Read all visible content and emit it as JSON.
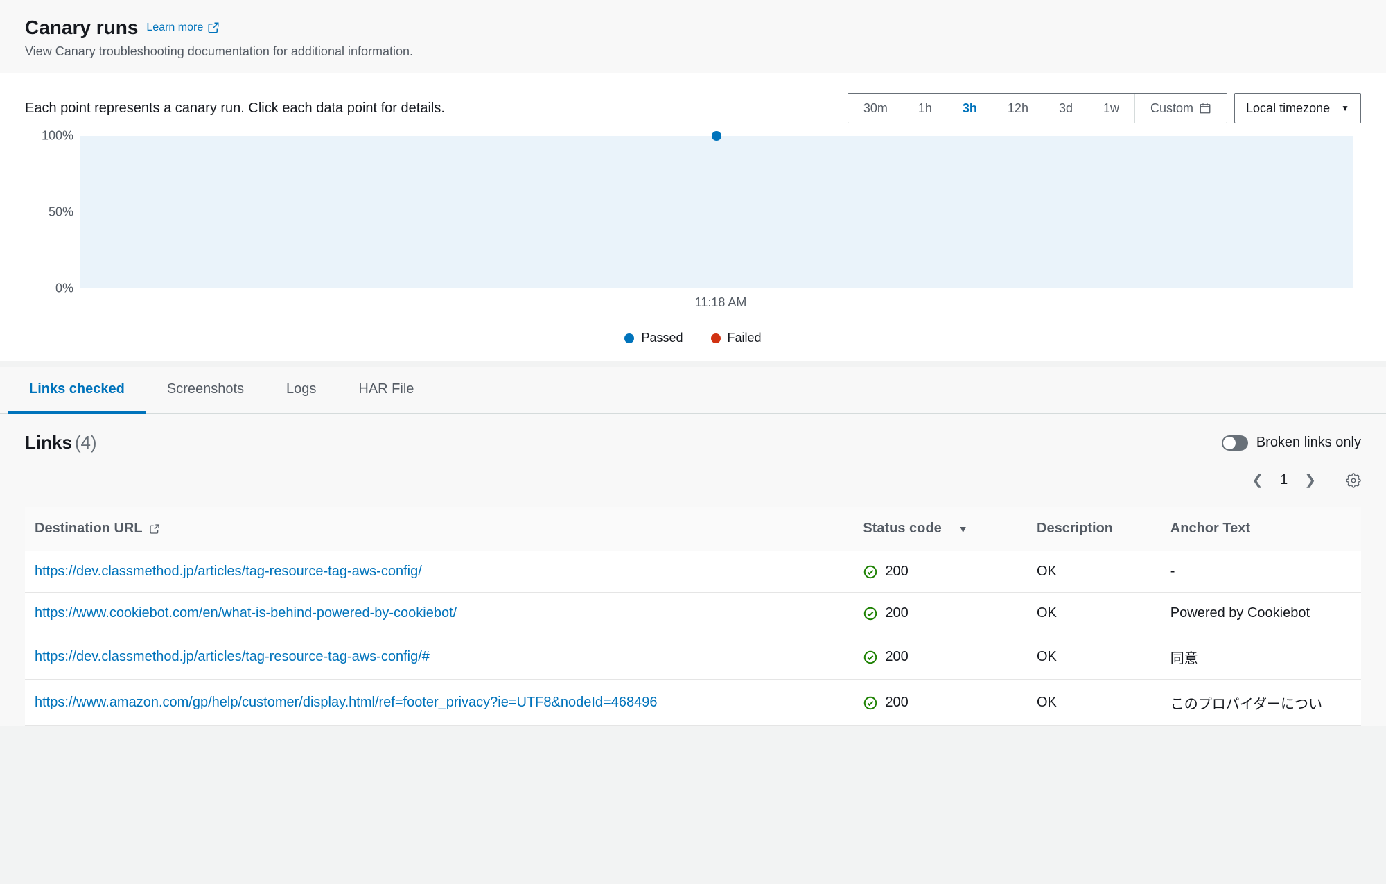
{
  "header": {
    "title": "Canary runs",
    "learn_more": "Learn more",
    "subtitle": "View Canary troubleshooting documentation for additional information."
  },
  "chart": {
    "hint": "Each point represents a canary run. Click each data point for details.",
    "ranges": [
      "30m",
      "1h",
      "3h",
      "12h",
      "3d",
      "1w"
    ],
    "selected_range": "3h",
    "custom_label": "Custom",
    "timezone_label": "Local timezone",
    "legend": {
      "passed": "Passed",
      "failed": "Failed"
    },
    "colors": {
      "passed": "#0073bb",
      "failed": "#d13212"
    }
  },
  "chart_data": {
    "type": "scatter",
    "ylabel": "",
    "ylim": [
      0,
      100
    ],
    "y_ticks": [
      "100%",
      "50%",
      "0%"
    ],
    "x_ticks": [
      "11:18 AM"
    ],
    "series": [
      {
        "name": "Passed",
        "color": "#0073bb",
        "points": [
          {
            "x": "11:18 AM",
            "y": 100
          }
        ]
      },
      {
        "name": "Failed",
        "color": "#d13212",
        "points": []
      }
    ]
  },
  "tabs": {
    "items": [
      "Links checked",
      "Screenshots",
      "Logs",
      "HAR File"
    ],
    "active": 0
  },
  "links": {
    "title": "Links",
    "count": "(4)",
    "broken_only": "Broken links only",
    "page_current": "1",
    "columns": {
      "url": "Destination URL",
      "status": "Status code",
      "desc": "Description",
      "anchor": "Anchor Text"
    },
    "rows": [
      {
        "url": "https://dev.classmethod.jp/articles/tag-resource-tag-aws-config/",
        "status": "200",
        "desc": "OK",
        "anchor": "-"
      },
      {
        "url": "https://www.cookiebot.com/en/what-is-behind-powered-by-cookiebot/",
        "status": "200",
        "desc": "OK",
        "anchor": "Powered by Cookiebot"
      },
      {
        "url": "https://dev.classmethod.jp/articles/tag-resource-tag-aws-config/#",
        "status": "200",
        "desc": "OK",
        "anchor": "同意"
      },
      {
        "url": "https://www.amazon.com/gp/help/customer/display.html/ref=footer_privacy?ie=UTF8&nodeId=468496",
        "status": "200",
        "desc": "OK",
        "anchor": "このプロバイダーについ"
      }
    ]
  }
}
